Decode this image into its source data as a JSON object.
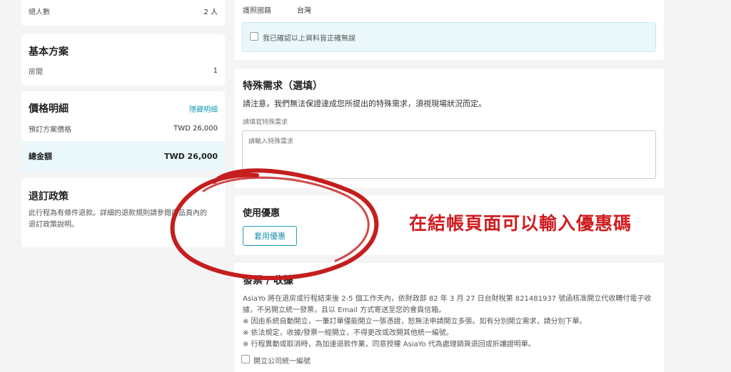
{
  "left": {
    "guests": {
      "label": "總人數",
      "value": "2 人"
    },
    "plan": {
      "title": "基本方案",
      "room_label": "房間",
      "room_value": "1"
    },
    "price": {
      "title": "價格明細",
      "hide_link": "隱藏明細",
      "plan_price_label": "預訂方案價格",
      "plan_price_value": "TWD 26,000",
      "total_label": "總金額",
      "total_value": "TWD 26,000"
    },
    "refund": {
      "title": "退訂政策",
      "line1": "此行程為有條件退款。詳細的退款規則請參閱商品頁內的",
      "line2": "退訂政策說明。"
    }
  },
  "right": {
    "passport": {
      "label": "護照國籍",
      "value": "台灣"
    },
    "confirm_label": "我已確認以上資料皆正確無誤",
    "special": {
      "title": "特殊需求（選填）",
      "notice": "請注意，我們無法保證達成您所提出的特殊需求，須視現場狀況而定。",
      "field_label": "請填寫特殊需求",
      "placeholder": "請輸入特殊需求"
    },
    "coupon": {
      "title": "使用優惠",
      "button": "套用優惠"
    },
    "invoice": {
      "title": "發票 / 收據",
      "lines": [
        "AsiaYo 將在退房或行程結束後 2-5 個工作天內，依財政部 82 年 3 月 27 日台財稅第 821481937 號函核准開立代收轉付電子收",
        "據，不另開立統一發票，且以 Email 方式寄送至您的會員信箱。",
        "※ 因由系統自動開立，一筆訂單僅能開立一張憑證，恕無法申請開立多張。如有分別開立需求，請分別下單。",
        "※ 依法規定，收據/發票一經開立，不得更改或改開其他統一編號。",
        "※ 行程異動或取消時，為加速退款作業，同意授權 AsiaYo 代為處理銷貨退回或折讓證明單。"
      ],
      "company_checkbox": "開立公司統一編號"
    }
  },
  "annotation": {
    "text": "在結帳頁面可以輸入優惠碼",
    "color": "#cf1d20"
  }
}
